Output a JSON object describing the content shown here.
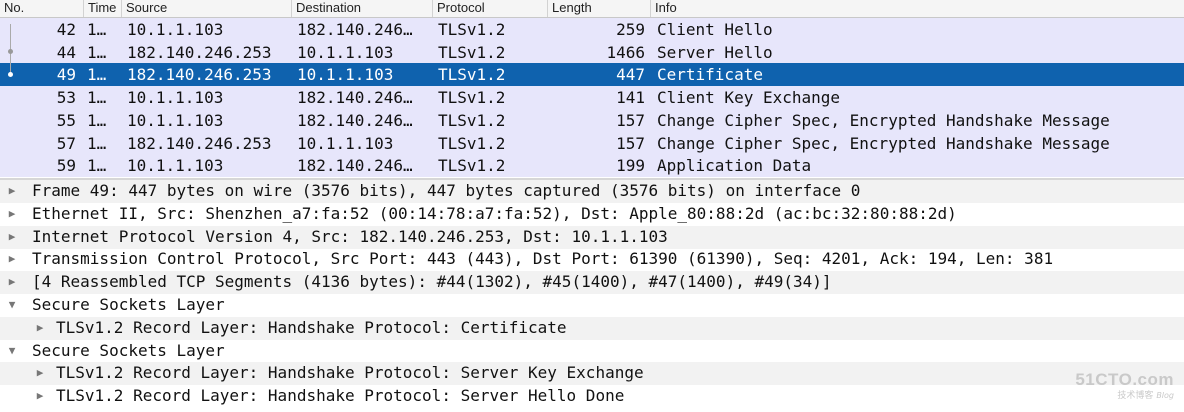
{
  "packet_list": {
    "columns": {
      "no": "No.",
      "time": "Time",
      "source": "Source",
      "destination": "Destination",
      "protocol": "Protocol",
      "length": "Length",
      "info": "Info"
    },
    "rows": [
      {
        "no": "42",
        "time": "1…",
        "source": "10.1.1.103",
        "destination": "182.140.246…",
        "protocol": "TLSv1.2",
        "length": "259",
        "info": "Client Hello"
      },
      {
        "no": "44",
        "time": "1…",
        "source": "182.140.246.253",
        "destination": "10.1.1.103",
        "protocol": "TLSv1.2",
        "length": "1466",
        "info": "Server Hello"
      },
      {
        "no": "49",
        "time": "1…",
        "source": "182.140.246.253",
        "destination": "10.1.1.103",
        "protocol": "TLSv1.2",
        "length": "447",
        "info": "Certificate",
        "selected": true
      },
      {
        "no": "53",
        "time": "1…",
        "source": "10.1.1.103",
        "destination": "182.140.246…",
        "protocol": "TLSv1.2",
        "length": "141",
        "info": "Client Key Exchange"
      },
      {
        "no": "55",
        "time": "1…",
        "source": "10.1.1.103",
        "destination": "182.140.246…",
        "protocol": "TLSv1.2",
        "length": "157",
        "info": "Change Cipher Spec, Encrypted Handshake Message"
      },
      {
        "no": "57",
        "time": "1…",
        "source": "182.140.246.253",
        "destination": "10.1.1.103",
        "protocol": "TLSv1.2",
        "length": "157",
        "info": "Change Cipher Spec, Encrypted Handshake Message"
      },
      {
        "no": "59",
        "time": "1…",
        "source": "10.1.1.103",
        "destination": "182.140.246…",
        "protocol": "TLSv1.2",
        "length": "199",
        "info": "Application Data"
      }
    ]
  },
  "details": [
    {
      "text": "Frame 49: 447 bytes on wire (3576 bits), 447 bytes captured (3576 bits) on interface 0",
      "expander": "collapsed",
      "level": 0
    },
    {
      "text": "Ethernet II, Src: Shenzhen_a7:fa:52 (00:14:78:a7:fa:52), Dst: Apple_80:88:2d (ac:bc:32:80:88:2d)",
      "expander": "collapsed",
      "level": 0
    },
    {
      "text": "Internet Protocol Version 4, Src: 182.140.246.253, Dst: 10.1.1.103",
      "expander": "collapsed",
      "level": 0
    },
    {
      "text": "Transmission Control Protocol, Src Port: 443 (443), Dst Port: 61390 (61390), Seq: 4201, Ack: 194, Len: 381",
      "expander": "collapsed",
      "level": 0
    },
    {
      "text": "[4 Reassembled TCP Segments (4136 bytes): #44(1302), #45(1400), #47(1400), #49(34)]",
      "expander": "collapsed",
      "level": 0
    },
    {
      "text": "Secure Sockets Layer",
      "expander": "expanded",
      "level": 0
    },
    {
      "text": "TLSv1.2 Record Layer: Handshake Protocol: Certificate",
      "expander": "collapsed",
      "level": 1
    },
    {
      "text": "Secure Sockets Layer",
      "expander": "expanded",
      "level": 0
    },
    {
      "text": "TLSv1.2 Record Layer: Handshake Protocol: Server Key Exchange",
      "expander": "collapsed",
      "level": 1
    },
    {
      "text": "TLSv1.2 Record Layer: Handshake Protocol: Server Hello Done",
      "expander": "collapsed",
      "level": 1
    }
  ],
  "watermark": {
    "logo": "51CTO.com",
    "subtitle": "技术博客",
    "tag": "Blog"
  },
  "colors": {
    "row_bg": "#e7e6fb",
    "selected_bg": "#0f62ae",
    "selected_fg": "#ffffff"
  }
}
